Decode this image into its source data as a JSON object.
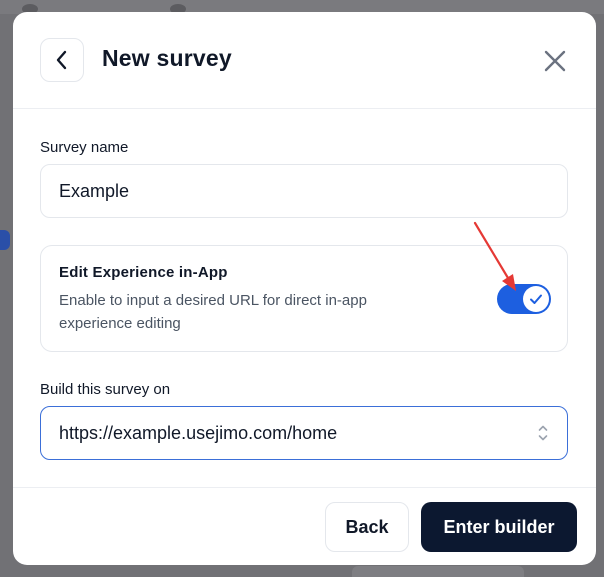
{
  "modal": {
    "title": "New survey"
  },
  "survey_name": {
    "label": "Survey name",
    "value": "Example"
  },
  "edit_in_app": {
    "title": "Edit Experience in-App",
    "description": "Enable to input a desired URL for direct in-app experience editing",
    "enabled": true
  },
  "build_on": {
    "label": "Build this survey on",
    "value": "https://example.usejimo.com/home"
  },
  "footer": {
    "back_label": "Back",
    "enter_label": "Enter builder"
  },
  "colors": {
    "toggle_on": "#1d5fe0",
    "primary_button": "#0c1830",
    "focus_border": "#3b6fd8",
    "annotation_arrow": "#e53935"
  },
  "icons": {
    "back": "chevron-left-icon",
    "close": "close-icon",
    "toggle_check": "check-icon",
    "select": "chevron-up-down-icon"
  }
}
